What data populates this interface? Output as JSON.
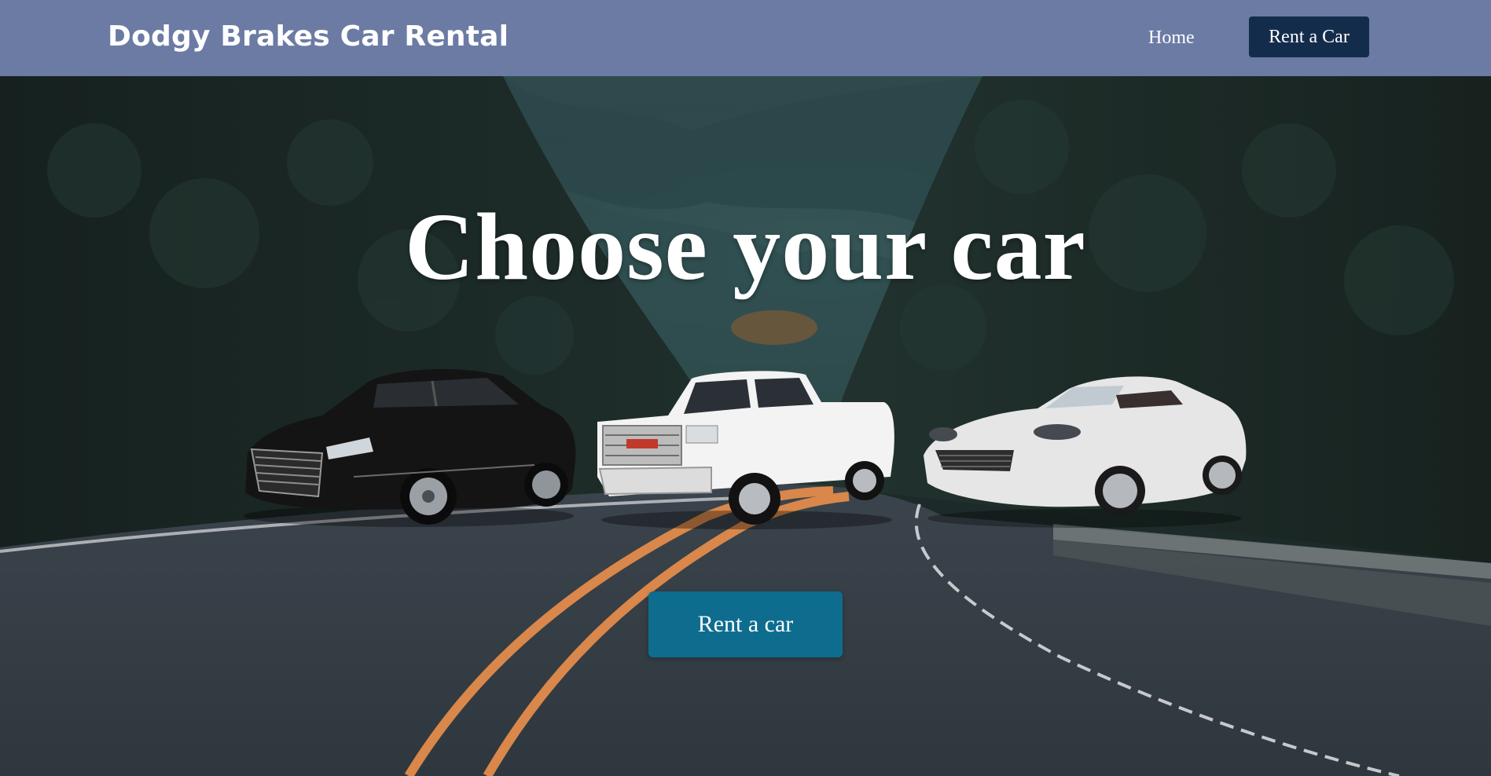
{
  "nav": {
    "brand": "Dodgy Brakes Car Rental",
    "home_label": "Home",
    "rent_label": "Rent a Car"
  },
  "hero": {
    "title": "Choose your car",
    "cta_label": "Rent a car"
  },
  "colors": {
    "navbar": "#6b7ba4",
    "nav_button": "#142c4c",
    "cta_button": "#0e6d8f",
    "road_line": "#e08a3c"
  },
  "cars": [
    {
      "name": "black-sedan",
      "color": "#151515"
    },
    {
      "name": "white-pickup-truck",
      "color": "#f2f2f2"
    },
    {
      "name": "silver-convertible",
      "color": "#e4e4e4"
    }
  ]
}
